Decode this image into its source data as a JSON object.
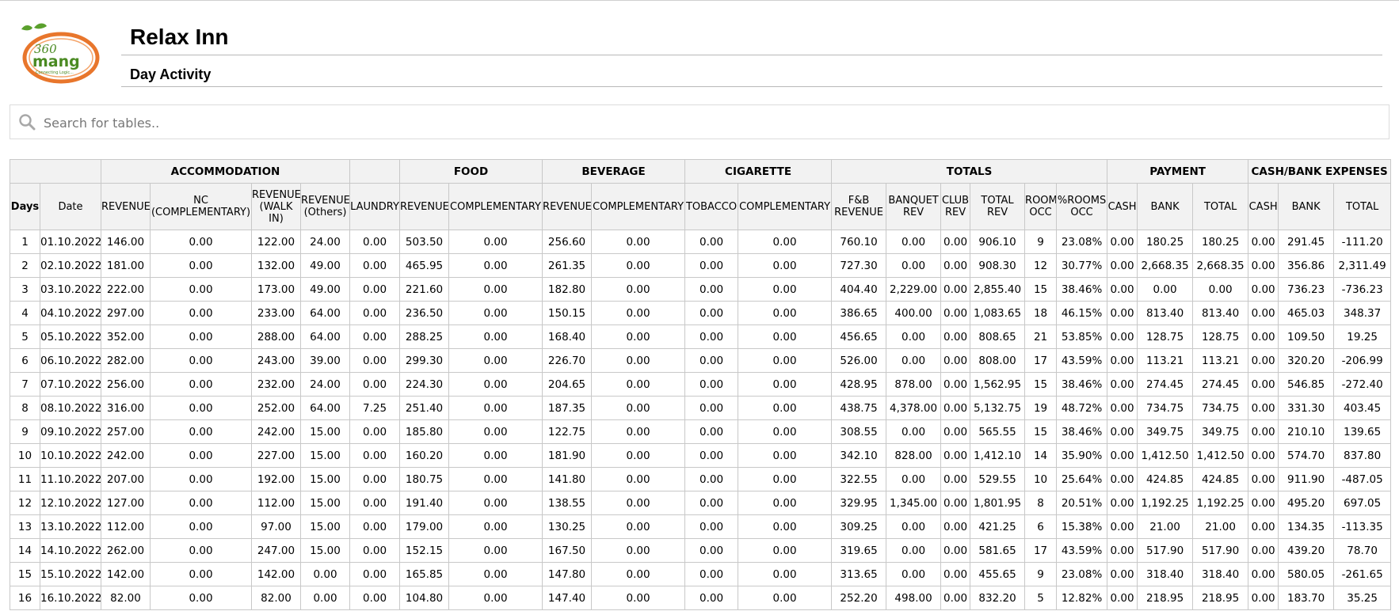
{
  "header": {
    "title": "Relax Inn",
    "subtitle": "Day Activity",
    "logo": {
      "text_main": "360",
      "text_brand": "mang",
      "tagline": "Connecting Logic...",
      "colors": {
        "ring": "#e8762c",
        "leaf": "#5aa02c",
        "text": "#4a8a22"
      }
    }
  },
  "search": {
    "placeholder": "Search for tables..",
    "value": "",
    "icon": "search-icon"
  },
  "table": {
    "groups": [
      {
        "label": "",
        "span": 2
      },
      {
        "label": "ACCOMMODATION",
        "span": 4
      },
      {
        "label": "",
        "span": 1
      },
      {
        "label": "FOOD",
        "span": 2
      },
      {
        "label": "BEVERAGE",
        "span": 2
      },
      {
        "label": "CIGARETTE",
        "span": 2
      },
      {
        "label": "TOTALS",
        "span": 6
      },
      {
        "label": "PAYMENT",
        "span": 3
      },
      {
        "label": "CASH/BANK EXPENSES",
        "span": 3
      }
    ],
    "columns": [
      "Days",
      "Date",
      "REVENUE",
      "NC (COMPLEMENTARY)",
      "REVENUE (WALK IN)",
      "REVENUE (Others)",
      "LAUNDRY",
      "REVENUE",
      "COMPLEMENTARY",
      "REVENUE",
      "COMPLEMENTARY",
      "TOBACCO",
      "COMPLEMENTARY",
      "F&B REVENUE",
      "BANQUET REV",
      "CLUB REV",
      "TOTAL REV",
      "ROOM OCC",
      "%ROOMS OCC",
      "CASH",
      "BANK",
      "TOTAL",
      "CASH",
      "BANK",
      "TOTAL"
    ],
    "rows": [
      [
        "1",
        "01.10.2022",
        "146.00",
        "0.00",
        "122.00",
        "24.00",
        "0.00",
        "503.50",
        "0.00",
        "256.60",
        "0.00",
        "0.00",
        "0.00",
        "760.10",
        "0.00",
        "0.00",
        "906.10",
        "9",
        "23.08%",
        "0.00",
        "180.25",
        "180.25",
        "0.00",
        "291.45",
        "-111.20"
      ],
      [
        "2",
        "02.10.2022",
        "181.00",
        "0.00",
        "132.00",
        "49.00",
        "0.00",
        "465.95",
        "0.00",
        "261.35",
        "0.00",
        "0.00",
        "0.00",
        "727.30",
        "0.00",
        "0.00",
        "908.30",
        "12",
        "30.77%",
        "0.00",
        "2,668.35",
        "2,668.35",
        "0.00",
        "356.86",
        "2,311.49"
      ],
      [
        "3",
        "03.10.2022",
        "222.00",
        "0.00",
        "173.00",
        "49.00",
        "0.00",
        "221.60",
        "0.00",
        "182.80",
        "0.00",
        "0.00",
        "0.00",
        "404.40",
        "2,229.00",
        "0.00",
        "2,855.40",
        "15",
        "38.46%",
        "0.00",
        "0.00",
        "0.00",
        "0.00",
        "736.23",
        "-736.23"
      ],
      [
        "4",
        "04.10.2022",
        "297.00",
        "0.00",
        "233.00",
        "64.00",
        "0.00",
        "236.50",
        "0.00",
        "150.15",
        "0.00",
        "0.00",
        "0.00",
        "386.65",
        "400.00",
        "0.00",
        "1,083.65",
        "18",
        "46.15%",
        "0.00",
        "813.40",
        "813.40",
        "0.00",
        "465.03",
        "348.37"
      ],
      [
        "5",
        "05.10.2022",
        "352.00",
        "0.00",
        "288.00",
        "64.00",
        "0.00",
        "288.25",
        "0.00",
        "168.40",
        "0.00",
        "0.00",
        "0.00",
        "456.65",
        "0.00",
        "0.00",
        "808.65",
        "21",
        "53.85%",
        "0.00",
        "128.75",
        "128.75",
        "0.00",
        "109.50",
        "19.25"
      ],
      [
        "6",
        "06.10.2022",
        "282.00",
        "0.00",
        "243.00",
        "39.00",
        "0.00",
        "299.30",
        "0.00",
        "226.70",
        "0.00",
        "0.00",
        "0.00",
        "526.00",
        "0.00",
        "0.00",
        "808.00",
        "17",
        "43.59%",
        "0.00",
        "113.21",
        "113.21",
        "0.00",
        "320.20",
        "-206.99"
      ],
      [
        "7",
        "07.10.2022",
        "256.00",
        "0.00",
        "232.00",
        "24.00",
        "0.00",
        "224.30",
        "0.00",
        "204.65",
        "0.00",
        "0.00",
        "0.00",
        "428.95",
        "878.00",
        "0.00",
        "1,562.95",
        "15",
        "38.46%",
        "0.00",
        "274.45",
        "274.45",
        "0.00",
        "546.85",
        "-272.40"
      ],
      [
        "8",
        "08.10.2022",
        "316.00",
        "0.00",
        "252.00",
        "64.00",
        "7.25",
        "251.40",
        "0.00",
        "187.35",
        "0.00",
        "0.00",
        "0.00",
        "438.75",
        "4,378.00",
        "0.00",
        "5,132.75",
        "19",
        "48.72%",
        "0.00",
        "734.75",
        "734.75",
        "0.00",
        "331.30",
        "403.45"
      ],
      [
        "9",
        "09.10.2022",
        "257.00",
        "0.00",
        "242.00",
        "15.00",
        "0.00",
        "185.80",
        "0.00",
        "122.75",
        "0.00",
        "0.00",
        "0.00",
        "308.55",
        "0.00",
        "0.00",
        "565.55",
        "15",
        "38.46%",
        "0.00",
        "349.75",
        "349.75",
        "0.00",
        "210.10",
        "139.65"
      ],
      [
        "10",
        "10.10.2022",
        "242.00",
        "0.00",
        "227.00",
        "15.00",
        "0.00",
        "160.20",
        "0.00",
        "181.90",
        "0.00",
        "0.00",
        "0.00",
        "342.10",
        "828.00",
        "0.00",
        "1,412.10",
        "14",
        "35.90%",
        "0.00",
        "1,412.50",
        "1,412.50",
        "0.00",
        "574.70",
        "837.80"
      ],
      [
        "11",
        "11.10.2022",
        "207.00",
        "0.00",
        "192.00",
        "15.00",
        "0.00",
        "180.75",
        "0.00",
        "141.80",
        "0.00",
        "0.00",
        "0.00",
        "322.55",
        "0.00",
        "0.00",
        "529.55",
        "10",
        "25.64%",
        "0.00",
        "424.85",
        "424.85",
        "0.00",
        "911.90",
        "-487.05"
      ],
      [
        "12",
        "12.10.2022",
        "127.00",
        "0.00",
        "112.00",
        "15.00",
        "0.00",
        "191.40",
        "0.00",
        "138.55",
        "0.00",
        "0.00",
        "0.00",
        "329.95",
        "1,345.00",
        "0.00",
        "1,801.95",
        "8",
        "20.51%",
        "0.00",
        "1,192.25",
        "1,192.25",
        "0.00",
        "495.20",
        "697.05"
      ],
      [
        "13",
        "13.10.2022",
        "112.00",
        "0.00",
        "97.00",
        "15.00",
        "0.00",
        "179.00",
        "0.00",
        "130.25",
        "0.00",
        "0.00",
        "0.00",
        "309.25",
        "0.00",
        "0.00",
        "421.25",
        "6",
        "15.38%",
        "0.00",
        "21.00",
        "21.00",
        "0.00",
        "134.35",
        "-113.35"
      ],
      [
        "14",
        "14.10.2022",
        "262.00",
        "0.00",
        "247.00",
        "15.00",
        "0.00",
        "152.15",
        "0.00",
        "167.50",
        "0.00",
        "0.00",
        "0.00",
        "319.65",
        "0.00",
        "0.00",
        "581.65",
        "17",
        "43.59%",
        "0.00",
        "517.90",
        "517.90",
        "0.00",
        "439.20",
        "78.70"
      ],
      [
        "15",
        "15.10.2022",
        "142.00",
        "0.00",
        "142.00",
        "0.00",
        "0.00",
        "165.85",
        "0.00",
        "147.80",
        "0.00",
        "0.00",
        "0.00",
        "313.65",
        "0.00",
        "0.00",
        "455.65",
        "9",
        "23.08%",
        "0.00",
        "318.40",
        "318.40",
        "0.00",
        "580.05",
        "-261.65"
      ],
      [
        "16",
        "16.10.2022",
        "82.00",
        "0.00",
        "82.00",
        "0.00",
        "0.00",
        "104.80",
        "0.00",
        "147.40",
        "0.00",
        "0.00",
        "0.00",
        "252.20",
        "498.00",
        "0.00",
        "832.20",
        "5",
        "12.82%",
        "0.00",
        "218.95",
        "218.95",
        "0.00",
        "183.70",
        "35.25"
      ]
    ]
  }
}
